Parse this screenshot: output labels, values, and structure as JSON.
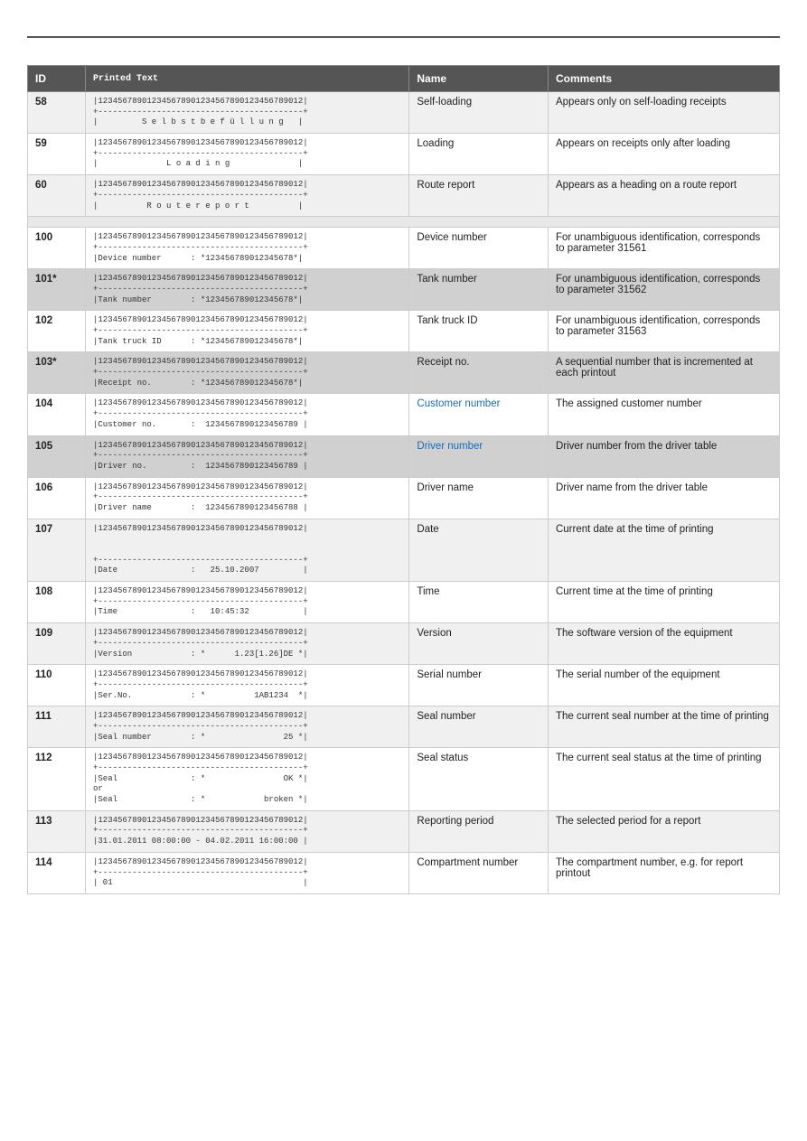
{
  "table": {
    "headers": [
      "ID",
      "Printed Text",
      "Name",
      "Comments"
    ],
    "rows": [
      {
        "id": "58",
        "printed": "|123456789012345678901234567890123456789012|\n+------------------------------------------+\n|         S e l b s t b e f ü l l u n g   |",
        "name": "Self-loading",
        "comments": "Appears only on self-loading receipts",
        "style": "even"
      },
      {
        "id": "59",
        "printed": "|123456789012345678901234567890123456789012|\n+------------------------------------------+\n|              L o a d i n g              |",
        "name": "Loading",
        "comments": "Appears on receipts only after loading",
        "style": "odd"
      },
      {
        "id": "60",
        "printed": "|123456789012345678901234567890123456789012|\n+------------------------------------------+\n|          R o u t e r e p o r t          |",
        "name": "Route report",
        "comments": "Appears as a heading on a route report",
        "style": "even"
      },
      {
        "id": "",
        "printed": "",
        "name": "",
        "comments": "",
        "style": "spacer"
      },
      {
        "id": "100",
        "printed": "|123456789012345678901234567890123456789012|\n+------------------------------------------+\n|Device number      : *123456789012345678*|",
        "name": "Device number",
        "comments": "For unambiguous identification, corresponds to parameter 31561",
        "style": "odd"
      },
      {
        "id": "101*",
        "printed": "|123456789012345678901234567890123456789012|\n+------------------------------------------+\n|Tank number        : *123456789012345678*|",
        "name": "Tank number",
        "comments": "For unambiguous identification, corresponds to parameter 31562",
        "style": "grey"
      },
      {
        "id": "102",
        "printed": "|123456789012345678901234567890123456789012|\n+------------------------------------------+\n|Tank truck ID      : *123456789012345678*|",
        "name": "Tank truck ID",
        "comments": "For unambiguous identification, corresponds to parameter 31563",
        "style": "odd"
      },
      {
        "id": "103*",
        "printed": "|123456789012345678901234567890123456789012|\n+------------------------------------------+\n|Receipt no.        : *123456789012345678*|",
        "name": "Receipt no.",
        "comments": "A sequential number that is incremented at each printout",
        "style": "grey"
      },
      {
        "id": "104",
        "printed": "|123456789012345678901234567890123456789012|\n+------------------------------------------+\n|Customer no.       :  1234567890123456789 |",
        "name": "Customer number",
        "name_highlight": true,
        "comments": "The assigned customer number",
        "style": "odd"
      },
      {
        "id": "105",
        "printed": "|123456789012345678901234567890123456789012|\n+------------------------------------------+\n|Driver no.         :  1234567890123456789 |",
        "name": "Driver number",
        "name_highlight": true,
        "comments": "Driver number from the driver table",
        "style": "grey"
      },
      {
        "id": "106",
        "printed": "|123456789012345678901234567890123456789012|\n+------------------------------------------+\n|Driver name        :  1234567890123456788 |",
        "name": "Driver name",
        "comments": "Driver name from the driver table",
        "style": "odd"
      },
      {
        "id": "107",
        "printed": "|123456789012345678901234567890123456789012|\n\n\n+------------------------------------------+\n|Date               :   25.10.2007         |",
        "name": "Date",
        "comments": "Current date\nat the time of printing",
        "style": "even"
      },
      {
        "id": "108",
        "printed": "|123456789012345678901234567890123456789012|\n+------------------------------------------+\n|Time               :   10:45:32           |",
        "name": "Time",
        "comments": "Current time\nat the time of printing",
        "style": "odd"
      },
      {
        "id": "109",
        "printed": "|123456789012345678901234567890123456789012|\n+------------------------------------------+\n|Version            : *      1.23[1.26]DE *|",
        "name": "Version",
        "comments": "The software version of the equipment",
        "style": "even"
      },
      {
        "id": "110",
        "printed": "|123456789012345678901234567890123456789012|\n+------------------------------------------+\n|Ser.No.            : *          1AB1234  *|",
        "name": "Serial number",
        "comments": "The serial number of the equipment",
        "style": "odd"
      },
      {
        "id": "111",
        "printed": "|123456789012345678901234567890123456789012|\n+------------------------------------------+\n|Seal number        : *                25 *|",
        "name": "Seal number",
        "comments": "The current seal number at the time of printing",
        "style": "even"
      },
      {
        "id": "112",
        "printed": "|123456789012345678901234567890123456789012|\n+------------------------------------------+\n|Seal               : *                OK *|\nor\n|Seal               : *            broken *|",
        "name": "Seal status",
        "comments": "The current seal status at the time of printing",
        "style": "odd"
      },
      {
        "id": "113",
        "printed": "|123456789012345678901234567890123456789012|\n+------------------------------------------+\n|31.01.2011 08:00:00 - 04.02.2011 16:00:00 |",
        "name": "Reporting period",
        "comments": "The selected period for a report",
        "style": "even"
      },
      {
        "id": "114",
        "printed": "|123456789012345678901234567890123456789012|\n+------------------------------------------+\n| 01                                       |",
        "name": "Compartment number",
        "comments": "The compartment number, e.g. for report printout",
        "style": "odd"
      }
    ]
  }
}
